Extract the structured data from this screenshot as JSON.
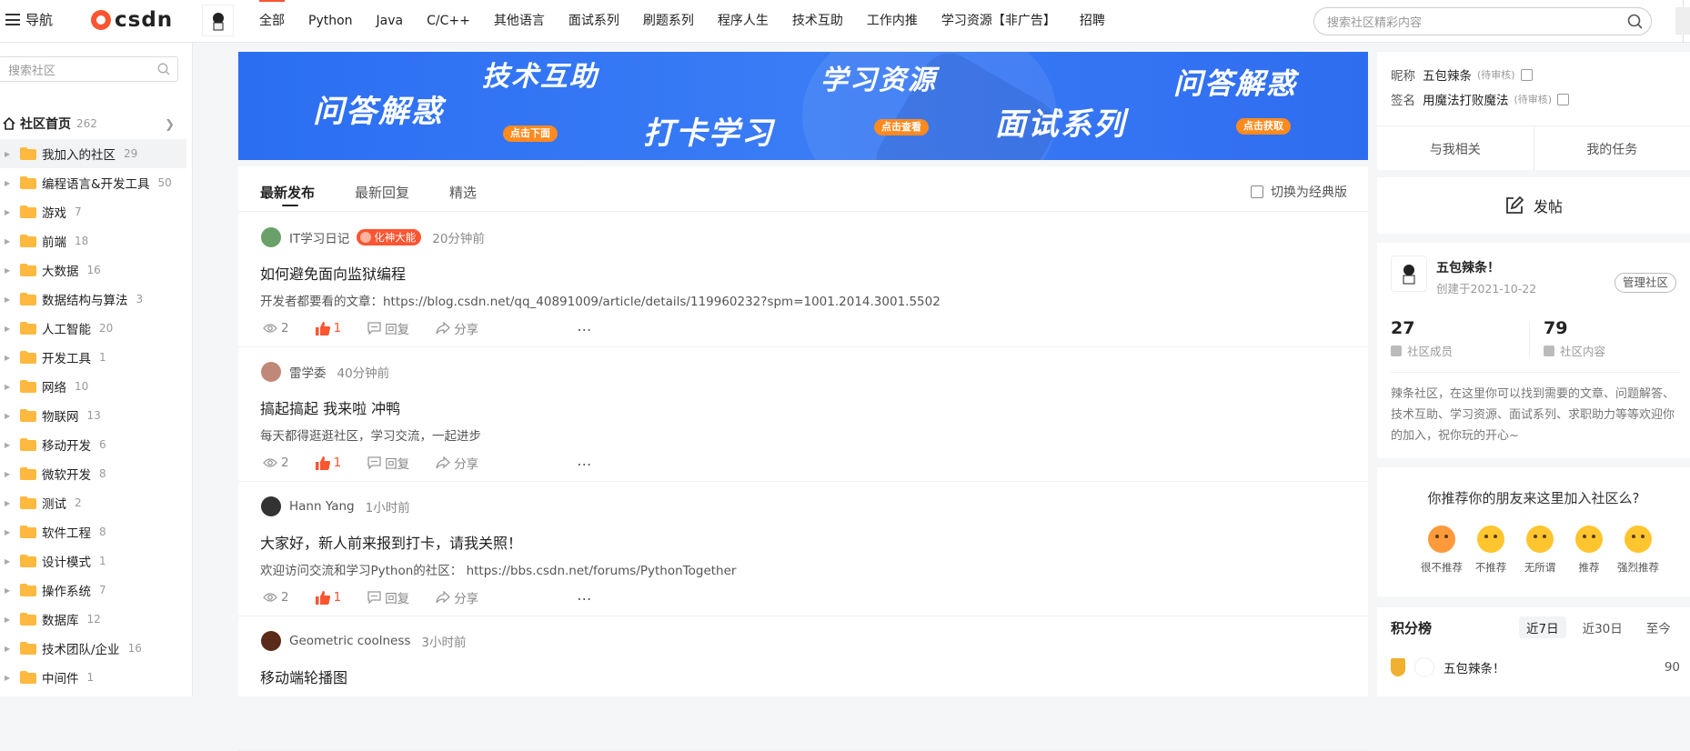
{
  "topbar": {
    "nav_label": "导航",
    "logo_text": "csdn",
    "tabs": [
      "全部",
      "Python",
      "Java",
      "C/C++",
      "其他语言",
      "面试系列",
      "刷题系列",
      "程序人生",
      "技术互助",
      "工作内推",
      "学习资源【非广告】",
      "招聘"
    ],
    "search_placeholder": "搜索社区精彩内容",
    "avatar_text": "五包辣条"
  },
  "sidebar": {
    "search_placeholder": "搜索社区",
    "home_label": "社区首页",
    "home_count": "262",
    "items": [
      {
        "label": "我加入的社区",
        "count": "29"
      },
      {
        "label": "编程语言&开发工具",
        "count": "50"
      },
      {
        "label": "游戏",
        "count": "7"
      },
      {
        "label": "前端",
        "count": "18"
      },
      {
        "label": "大数据",
        "count": "16"
      },
      {
        "label": "数据结构与算法",
        "count": "3"
      },
      {
        "label": "人工智能",
        "count": "20"
      },
      {
        "label": "开发工具",
        "count": "1"
      },
      {
        "label": "网络",
        "count": "10"
      },
      {
        "label": "物联网",
        "count": "13"
      },
      {
        "label": "移动开发",
        "count": "6"
      },
      {
        "label": "微软开发",
        "count": "8"
      },
      {
        "label": "测试",
        "count": "2"
      },
      {
        "label": "软件工程",
        "count": "8"
      },
      {
        "label": "设计模式",
        "count": "1"
      },
      {
        "label": "操作系统",
        "count": "7"
      },
      {
        "label": "数据库",
        "count": "12"
      },
      {
        "label": "技术团队/企业",
        "count": "16"
      },
      {
        "label": "中间件",
        "count": "1"
      }
    ]
  },
  "banner": {
    "t1": "问答解惑",
    "t2": "技术互助",
    "t2_pill": "点击下面",
    "t3": "打卡学习",
    "t4": "学习资源",
    "t4_pill": "点击查看",
    "t5": "面试系列",
    "t6": "问答解惑",
    "t6_pill": "点击获取"
  },
  "feed": {
    "tabs": [
      "最新发布",
      "最新回复",
      "精选"
    ],
    "switch_label": "切换为经典版",
    "reply_label": "回复",
    "share_label": "分享",
    "posts": [
      {
        "author": "IT学习日记",
        "badge": "化神大能",
        "time": "20分钟前",
        "title": "如何避免面向监狱编程",
        "body": "开发者都要看的文章：https://blog.csdn.net/qq_40891009/article/details/119960232?spm=1001.2014.3001.5502",
        "views": "2",
        "likes": "1",
        "avatar_color": "#6aa06a"
      },
      {
        "author": "雷学委",
        "badge": "",
        "time": "40分钟前",
        "title": "搞起搞起 我来啦 冲鸭",
        "body": "每天都得逛逛社区，学习交流，一起进步",
        "views": "2",
        "likes": "1",
        "avatar_color": "#c08878"
      },
      {
        "author": "Hann Yang",
        "badge": "",
        "time": "1小时前",
        "title": "大家好，新人前来报到打卡，请我关照！",
        "body": "欢迎访问交流和学习Python的社区： https://bbs.csdn.net/forums/PythonTogether",
        "views": "2",
        "likes": "1",
        "avatar_color": "#333333"
      },
      {
        "author": "Geometric coolness",
        "badge": "",
        "time": "3小时前",
        "title": "移动端轮播图",
        "body": "",
        "views": "",
        "likes": "",
        "avatar_color": "#5a2a1a"
      }
    ]
  },
  "profile": {
    "nick_label": "昵称",
    "nick_value": "五包辣条",
    "nick_status": "(待审核)",
    "sign_label": "签名",
    "sign_value": "用魔法打败魔法",
    "sign_status": "(待审核)",
    "tab_related": "与我相关",
    "tab_tasks": "我的任务"
  },
  "post_button": "发帖",
  "community": {
    "avatar_text": "五包辣条",
    "name": "五包辣条！",
    "created": "创建于2021-10-22",
    "manage_label": "管理社区",
    "members_num": "27",
    "members_label": "社区成员",
    "content_num": "79",
    "content_label": "社区内容",
    "description": "辣条社区，在这里你可以找到需要的文章、问题解答、技术互助、学习资源、面试系列、求职助力等等欢迎你的加入，祝你玩的开心~"
  },
  "recommend": {
    "question": "你推荐你的朋友来这里加入社区么?",
    "options": [
      "很不推荐",
      "不推荐",
      "无所谓",
      "推荐",
      "强烈推荐"
    ]
  },
  "ranking": {
    "title": "积分榜",
    "tabs": [
      "近7日",
      "近30日",
      "至今"
    ],
    "entries": [
      {
        "name": "五包辣条！",
        "score": "90"
      }
    ]
  },
  "colors": {
    "accent": "#fc5531",
    "banner": "#2b6ef2"
  }
}
